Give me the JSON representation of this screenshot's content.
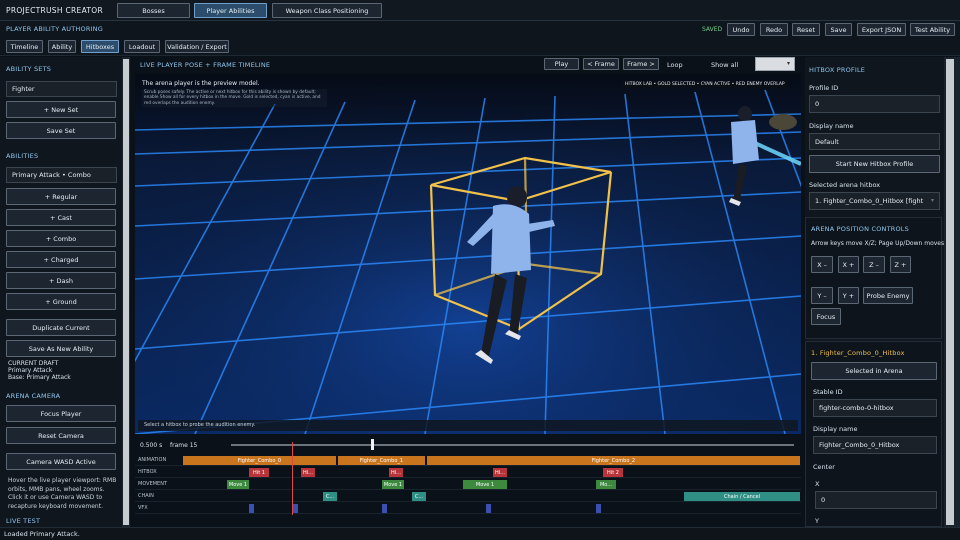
{
  "app": {
    "title": "PROJECTRUSH CREATOR"
  },
  "main_tabs": [
    {
      "label": "Bosses"
    },
    {
      "label": "Player Abilities"
    },
    {
      "label": "Weapon Class Positioning"
    }
  ],
  "header": {
    "title": "PLAYER ABILITY AUTHORING",
    "saved": "SAVED",
    "actions": [
      "Undo",
      "Redo",
      "Reset",
      "Save",
      "Export JSON",
      "Test Ability"
    ]
  },
  "sub_tabs": [
    "Timeline",
    "Ability",
    "Hitboxes",
    "Loadout",
    "Validation / Export"
  ],
  "left": {
    "ability_sets_title": "ABILITY SETS",
    "set_value": "Fighter",
    "new_set": "+ New Set",
    "save_set": "Save Set",
    "abilities_title": "ABILITIES",
    "ability_select": "Primary Attack  •  Combo",
    "ability_buttons": [
      "+ Regular",
      "+ Cast",
      "+ Combo",
      "+ Charged",
      "+ Dash",
      "+ Ground"
    ],
    "duplicate": "Duplicate Current",
    "save_new": "Save As New Ability",
    "draft_title": "CURRENT DRAFT",
    "draft_name": "Primary Attack",
    "draft_base": "Base: Primary Attack",
    "camera_title": "ARENA CAMERA",
    "focus_player": "Focus Player",
    "reset_camera": "Reset Camera",
    "camera_wasd": "Camera WASD Active",
    "hint": "Hover the live player viewport: RMB orbits, MMB pans, wheel zooms. Click it or use Camera WASD to recapture keyboard movement.",
    "live_test_title": "LIVE TEST"
  },
  "viewport": {
    "title": "LIVE PLAYER POSE + FRAME TIMELINE",
    "play": "Play",
    "prev_frame": "< Frame",
    "next_frame": "Frame >",
    "loop": "Loop",
    "show_all": "Show all",
    "overlay_title": "The arena player is the preview model.",
    "overlay_desc": "Scrub poses safely. The active or next hitbox for this ability is shown by default; enable Show all for every hitbox in the move. Gold is selected, cyan is active, and red overlaps the audition enemy.",
    "legend": "HITBOX LAB  •  GOLD SELECTED  •  CYAN ACTIVE  •  RED ENEMY OVERLAP",
    "probe_hint": "Select a hitbox to probe the audition enemy.",
    "time": "0.500 s",
    "frame": "frame 15",
    "scrub_progress": 0.25
  },
  "timeline": {
    "rows": [
      "ANIMATION",
      "HITBOX",
      "MOVEMENT",
      "CHAIN",
      "VFX"
    ],
    "animation": [
      "Fighter_Combo_0",
      "Fighter_Combo_1",
      "Fighter_Combo_2"
    ],
    "hitbox": [
      "Hit 1",
      "Hi...",
      "Hi...",
      "Hi...",
      "Hit 2"
    ],
    "movement": [
      "Move 1",
      "Move 1",
      "Move 1",
      "Mo..."
    ],
    "chain": [
      "C...",
      "C...",
      "Chain / Cancel"
    ]
  },
  "right": {
    "profile_title": "HITBOX PROFILE",
    "profile_id_label": "Profile ID",
    "profile_id": "0",
    "display_name_label": "Display name",
    "display_name": "Default",
    "start_new": "Start New Hitbox Profile",
    "selected_label": "Selected arena hitbox",
    "selected_value": "1. Fighter_Combo_0_Hitbox  [fight",
    "controls_title": "ARENA POSITION CONTROLS",
    "controls_hint": "Arrow keys move X/Z; Page Up/Down moves Y",
    "pos_buttons_row1": [
      "X –",
      "X +",
      "Z –",
      "Z +"
    ],
    "pos_buttons_row2": [
      "Y –",
      "Y +",
      "Probe Enemy"
    ],
    "focus": "Focus",
    "hitbox_title": "1. Fighter_Combo_0_Hitbox",
    "selected_in_arena": "Selected in Arena",
    "stable_id_label": "Stable ID",
    "stable_id": "fighter-combo-0-hitbox",
    "hb_display_label": "Display name",
    "hb_display": "Fighter_Combo_0_Hitbox",
    "center_label": "Center",
    "x_label": "X",
    "x_value": "0",
    "y_label": "Y"
  },
  "status": {
    "text": "Loaded Primary Attack."
  },
  "colors": {
    "accent": "#8fc8ef",
    "selected_box": "#f2c14a",
    "grid": "#2b8cff"
  }
}
